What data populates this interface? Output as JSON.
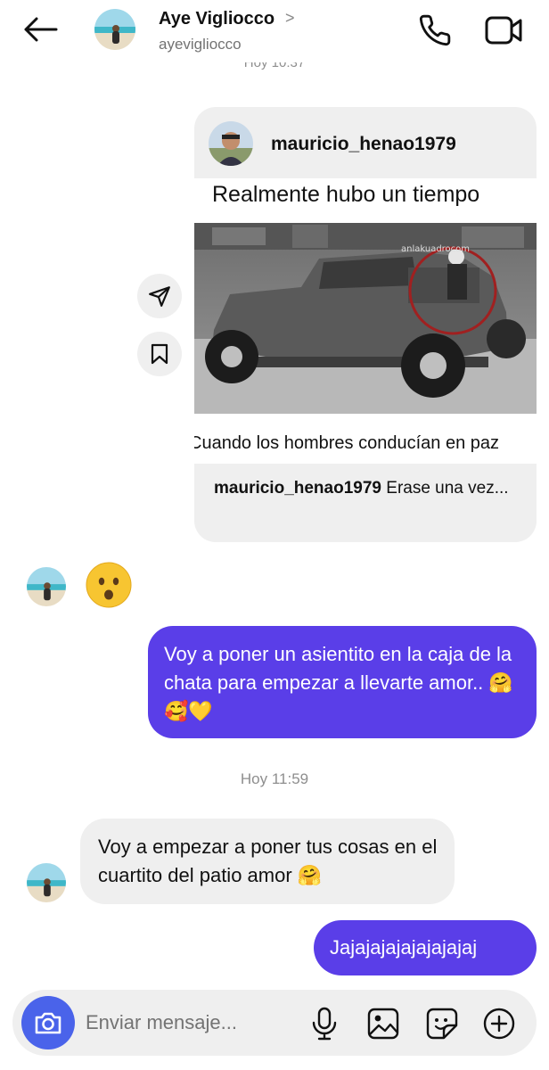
{
  "header": {
    "name": "Aye Vigliocco",
    "chevron": ">",
    "username": "ayevigliocco",
    "top_timestamp": "Hoy 10:37"
  },
  "shared_post": {
    "username": "mauricio_henao1979",
    "image_text_top": "Realmente hubo un tiempo",
    "image_text_bottom": "Cuando los hombres conducían en paz",
    "caption_user": "mauricio_henao1979",
    "caption_text": "Erase una vez..."
  },
  "messages": [
    {
      "direction": "in",
      "text": "😦"
    },
    {
      "direction": "out",
      "text": "Voy a poner un asientito en la caja de la chata para empezar a llevarte amor.. 🤗🥰💛"
    },
    {
      "direction": "in",
      "text": "Voy a empezar a poner tus cosas en el cuartito del patio amor 🤗"
    },
    {
      "direction": "out",
      "text": "Jajajajajajajajajaj"
    }
  ],
  "mid_timestamp": "Hoy 11:59",
  "composer": {
    "placeholder": "Enviar mensaje..."
  },
  "colors": {
    "outgoing_bubble": "#5a3ee8",
    "incoming_bubble": "#efefef",
    "camera_button": "#4a63ea"
  },
  "icons": [
    "back-arrow-icon",
    "phone-icon",
    "video-icon",
    "send-icon",
    "bookmark-icon",
    "camera-icon",
    "microphone-icon",
    "gallery-icon",
    "sticker-icon",
    "plus-icon"
  ]
}
